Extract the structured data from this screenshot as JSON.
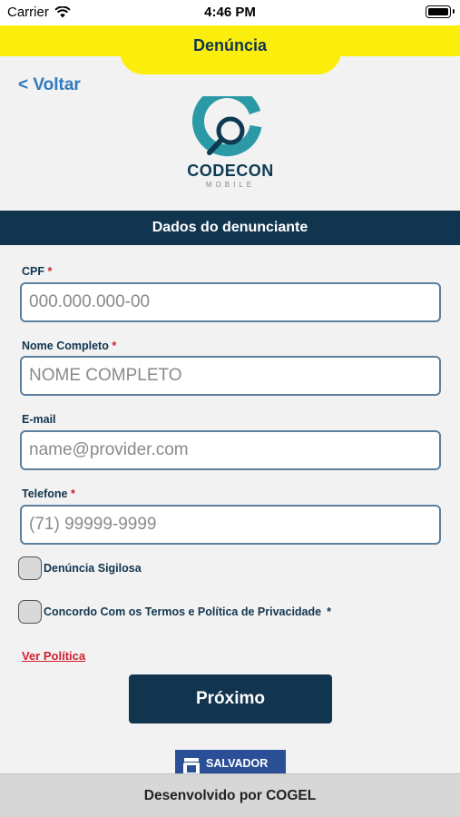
{
  "status_bar": {
    "carrier": "Carrier",
    "time": "4:46 PM",
    "wifi_icon": "wifi-icon",
    "battery_icon": "battery-icon"
  },
  "header": {
    "title": "Denúncia",
    "back_label": "< Voltar"
  },
  "logo": {
    "name": "CODECON",
    "subtitle": "MOBILE",
    "icon": "magnifier-c-icon"
  },
  "section": {
    "title": "Dados do denunciante"
  },
  "form": {
    "cpf": {
      "label": "CPF",
      "required_mark": "*",
      "placeholder": "000.000.000-00",
      "value": ""
    },
    "nome": {
      "label": "Nome Completo",
      "required_mark": "*",
      "placeholder": "NOME COMPLETO",
      "value": ""
    },
    "email": {
      "label": "E-mail",
      "placeholder": "name@provider.com",
      "value": ""
    },
    "telefone": {
      "label": "Telefone",
      "required_mark": "*",
      "placeholder": "(71) 99999-9999",
      "value": ""
    }
  },
  "checks": {
    "sigilosa": {
      "label": "Denúncia Sigilosa",
      "checked": false
    },
    "termos": {
      "label": "Concordo Com os Termos e Política de Privacidade",
      "required_mark": "*",
      "checked": false
    }
  },
  "policy_link": "Ver Política",
  "next_button": "Próximo",
  "sponsor": {
    "name": "SALVADOR",
    "emblem": "city-emblem-icon"
  },
  "footer": {
    "text": "Desenvolvido por COGEL"
  },
  "colors": {
    "accent_yellow": "#fbee0c",
    "navy": "#12354f",
    "link_blue": "#2f7ac0",
    "required_red": "#d0202f",
    "logo_teal": "#2b9aa6"
  }
}
